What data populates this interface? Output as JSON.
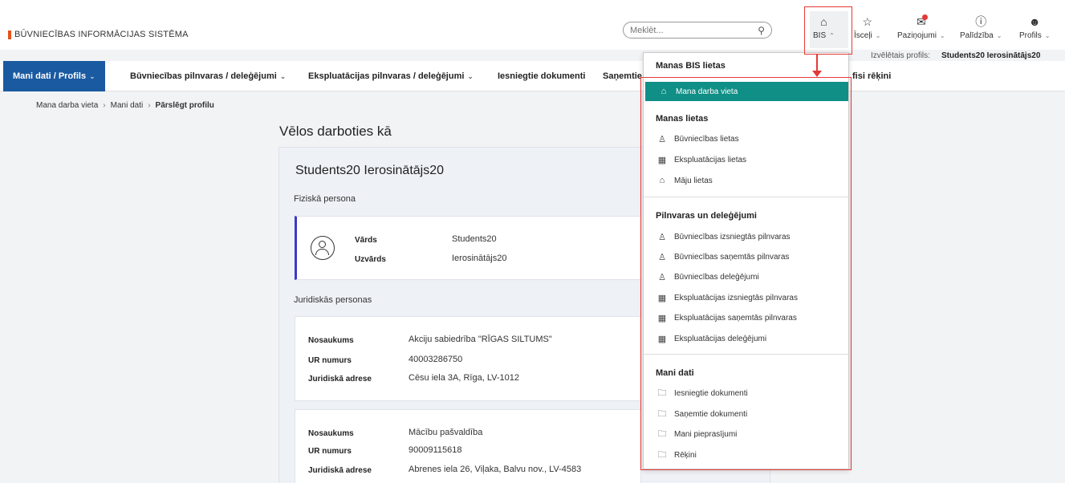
{
  "header": {
    "brand": "BŪVNIECĪBAS INFORMĀCIJAS SISTĒMA",
    "search_placeholder": "Meklēt...",
    "nav": [
      {
        "label": "BIS",
        "icon": "home-icon"
      },
      {
        "label": "Īsceļi",
        "icon": "star-icon"
      },
      {
        "label": "Paziņojumi",
        "icon": "mail-icon"
      },
      {
        "label": "Palīdzība",
        "icon": "help-icon"
      },
      {
        "label": "Profils",
        "icon": "user-icon"
      }
    ],
    "selected_profile_label": "Izvēlētais profils:",
    "selected_profile_value": "Students20 Ierosinātājs20"
  },
  "mainnav": [
    "Mani dati / Profils",
    "Būvniecības pilnvaras / deleģējumi",
    "Ekspluatācijas pilnvaras / deleģējumi",
    "Iesniegtie dokumenti",
    "Saņemtie",
    "fisi rēķini"
  ],
  "breadcrumb": [
    "Mana darba vieta",
    "Mani dati",
    "Pārslēgt profilu"
  ],
  "page": {
    "title": "Vēlos darboties kā",
    "person_name": "Students20 Ierosinātājs20",
    "physical_label": "Fiziskā persona",
    "person": {
      "name_label": "Vārds",
      "name_value": "Students20",
      "surname_label": "Uzvārds",
      "surname_value": "Ierosinātājs20"
    },
    "legal_label": "Juridiskās personas",
    "orgs": [
      {
        "name_label": "Nosaukums",
        "name_value": "Akciju sabiedrība \"RĪGAS SILTUMS\"",
        "reg_label": "UR numurs",
        "reg_value": "40003286750",
        "addr_label": "Juridiskā adrese",
        "addr_value": "Cēsu iela 3A, Rīga, LV-1012"
      },
      {
        "name_label": "Nosaukums",
        "name_value": "Mācību pašvaldība",
        "reg_label": "UR numurs",
        "reg_value": "90009115618",
        "addr_label": "Juridiskā adrese",
        "addr_value": "Abrenes iela 26, Viļaka, Balvu nov., LV-4583"
      }
    ]
  },
  "dropdown": {
    "title": "Manas BIS lietas",
    "active_item": "Mana darba vieta",
    "sections": [
      {
        "title": "Manas lietas",
        "items": [
          {
            "label": "Būvniecības lietas",
            "icon": "worker-icon"
          },
          {
            "label": "Ekspluatācijas lietas",
            "icon": "building-icon"
          },
          {
            "label": "Māju lietas",
            "icon": "houses-icon"
          }
        ]
      },
      {
        "title": "Pilnvaras un deleģējumi",
        "items": [
          {
            "label": "Būvniecības izsniegtās pilnvaras",
            "icon": "worker-icon"
          },
          {
            "label": "Būvniecības saņemtās pilnvaras",
            "icon": "worker-icon"
          },
          {
            "label": "Būvniecības deleģējumi",
            "icon": "worker-icon"
          },
          {
            "label": "Ekspluatācijas izsniegtās pilnvaras",
            "icon": "building-icon"
          },
          {
            "label": "Ekspluatācijas saņemtās pilnvaras",
            "icon": "building-icon"
          },
          {
            "label": "Ekspluatācijas deleģējumi",
            "icon": "building-icon"
          }
        ]
      },
      {
        "title": "Mani dati",
        "items": [
          {
            "label": "Iesniegtie dokumenti",
            "icon": "folder-icon"
          },
          {
            "label": "Saņemtie dokumenti",
            "icon": "folder-icon"
          },
          {
            "label": "Mani pieprasījumi",
            "icon": "folder-icon"
          },
          {
            "label": "Rēķini",
            "icon": "folder-icon"
          }
        ]
      }
    ]
  },
  "colors": {
    "accent_blue": "#1a5aa0",
    "teal_active": "#0f8f86",
    "annotation_red": "#e53935",
    "brand_orange": "#e3541a"
  }
}
